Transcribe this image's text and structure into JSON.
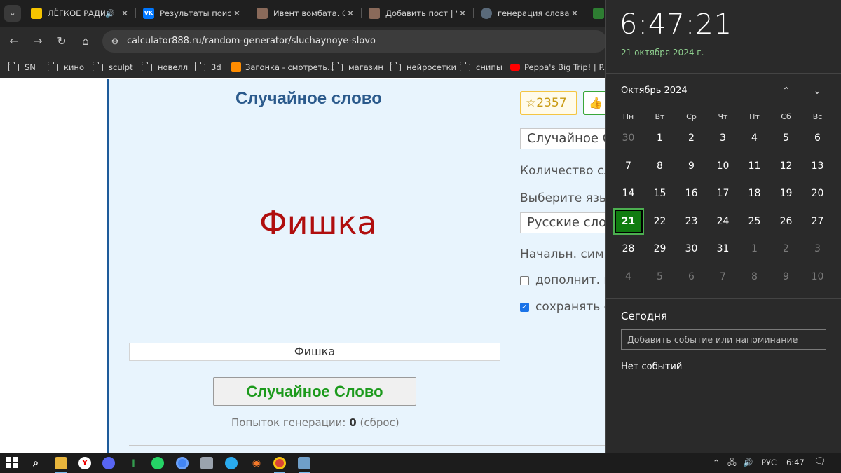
{
  "browser": {
    "tabs": [
      {
        "label": "ЛЁГКОЕ РАДИ",
        "audio": "🔊"
      },
      {
        "label": "Результаты поиск"
      },
      {
        "label": "Ивент вомбата. С"
      },
      {
        "label": "Добавить пост | V"
      },
      {
        "label": "генерация слова"
      }
    ],
    "url": "calculator888.ru/random-generator/sluchaynoye-slovo",
    "bookmarks": [
      {
        "label": "SN"
      },
      {
        "label": "кино"
      },
      {
        "label": "sculpt"
      },
      {
        "label": "новелл"
      },
      {
        "label": "3d"
      },
      {
        "label": "Загонка - смотреть..."
      },
      {
        "label": "магазин"
      },
      {
        "label": "нейросетки"
      },
      {
        "label": "снипы"
      },
      {
        "label": "Peppa's Big Trip! | P..."
      }
    ]
  },
  "calculator": {
    "title": "Случайное слово",
    "result_word": "Фишка",
    "result_field": "Фишка",
    "generate_button": "Случайное Слово",
    "attempts_label": "Попыток генерации:",
    "attempts_count": "0",
    "reset_open": "(",
    "reset_link": "сброс",
    "reset_close": ")",
    "rating": "2357",
    "rating_star": "☆",
    "like_icon": "👍",
    "mode_select": "Случайное С",
    "count_label": "Количество сл",
    "language_label": "Выберите язы",
    "language_select": "Русские слов",
    "start_chars_label": "Начальн. симв",
    "extra_option": "дополнит. н",
    "save_option": "сохранять с",
    "extra_checked": false,
    "save_checked": true
  },
  "flyout": {
    "time": "6:47:21",
    "date": "21 октября 2024 г.",
    "month": "Октябрь 2024",
    "weekdays": [
      "Пн",
      "Вт",
      "Ср",
      "Чт",
      "Пт",
      "Сб",
      "Вс"
    ],
    "weeks": [
      [
        "30",
        "1",
        "2",
        "3",
        "4",
        "5",
        "6"
      ],
      [
        "7",
        "8",
        "9",
        "10",
        "11",
        "12",
        "13"
      ],
      [
        "14",
        "15",
        "16",
        "17",
        "18",
        "19",
        "20"
      ],
      [
        "21",
        "22",
        "23",
        "24",
        "25",
        "26",
        "27"
      ],
      [
        "28",
        "29",
        "30",
        "31",
        "1",
        "2",
        "3"
      ],
      [
        "4",
        "5",
        "6",
        "7",
        "8",
        "9",
        "10"
      ]
    ],
    "today": "21",
    "today_section": "Сегодня",
    "event_placeholder": "Добавить событие или напоминание",
    "no_events": "Нет событий"
  },
  "taskbar": {
    "language": "РУС",
    "time": "6:47"
  },
  "colors": {
    "accent_green": "#107c10",
    "result_red": "#b00e0e",
    "title_blue": "#2b5a8c",
    "button_green": "#1c9a1c"
  }
}
